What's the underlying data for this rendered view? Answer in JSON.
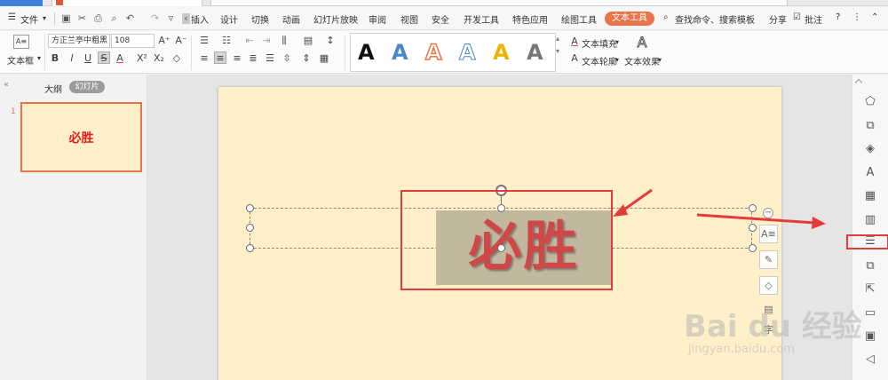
{
  "menu": {
    "file_label": "文件",
    "tabs": [
      "插入",
      "设计",
      "切换",
      "动画",
      "幻灯片放映",
      "审阅",
      "视图",
      "安全",
      "开发工具",
      "特色应用",
      "绘图工具",
      "文本工具"
    ],
    "search_label": "查找命令、搜索模板",
    "share_label": "分享",
    "comment_label": "批注",
    "help_label": "?"
  },
  "ribbon": {
    "textbox_label": "文本框",
    "font_name": "方正兰亭中粗黑",
    "font_size": "108",
    "text_fill_label": "文本填充",
    "text_outline_label": "文本轮廓",
    "text_effect_label": "文本效果",
    "gallery_letter": "A"
  },
  "panel": {
    "outline_tab": "大纲",
    "slides_tab": "幻灯片",
    "slide_number": "1"
  },
  "slide": {
    "text": "必胜"
  },
  "watermark": {
    "brand": "Bai du 经验",
    "url": "jingyan.baidu.com"
  },
  "colors": {
    "accent": "#e8754a",
    "slide_bg": "#fff0c9",
    "title_red": "#cf4747",
    "annotation_red": "#e33b3b"
  }
}
